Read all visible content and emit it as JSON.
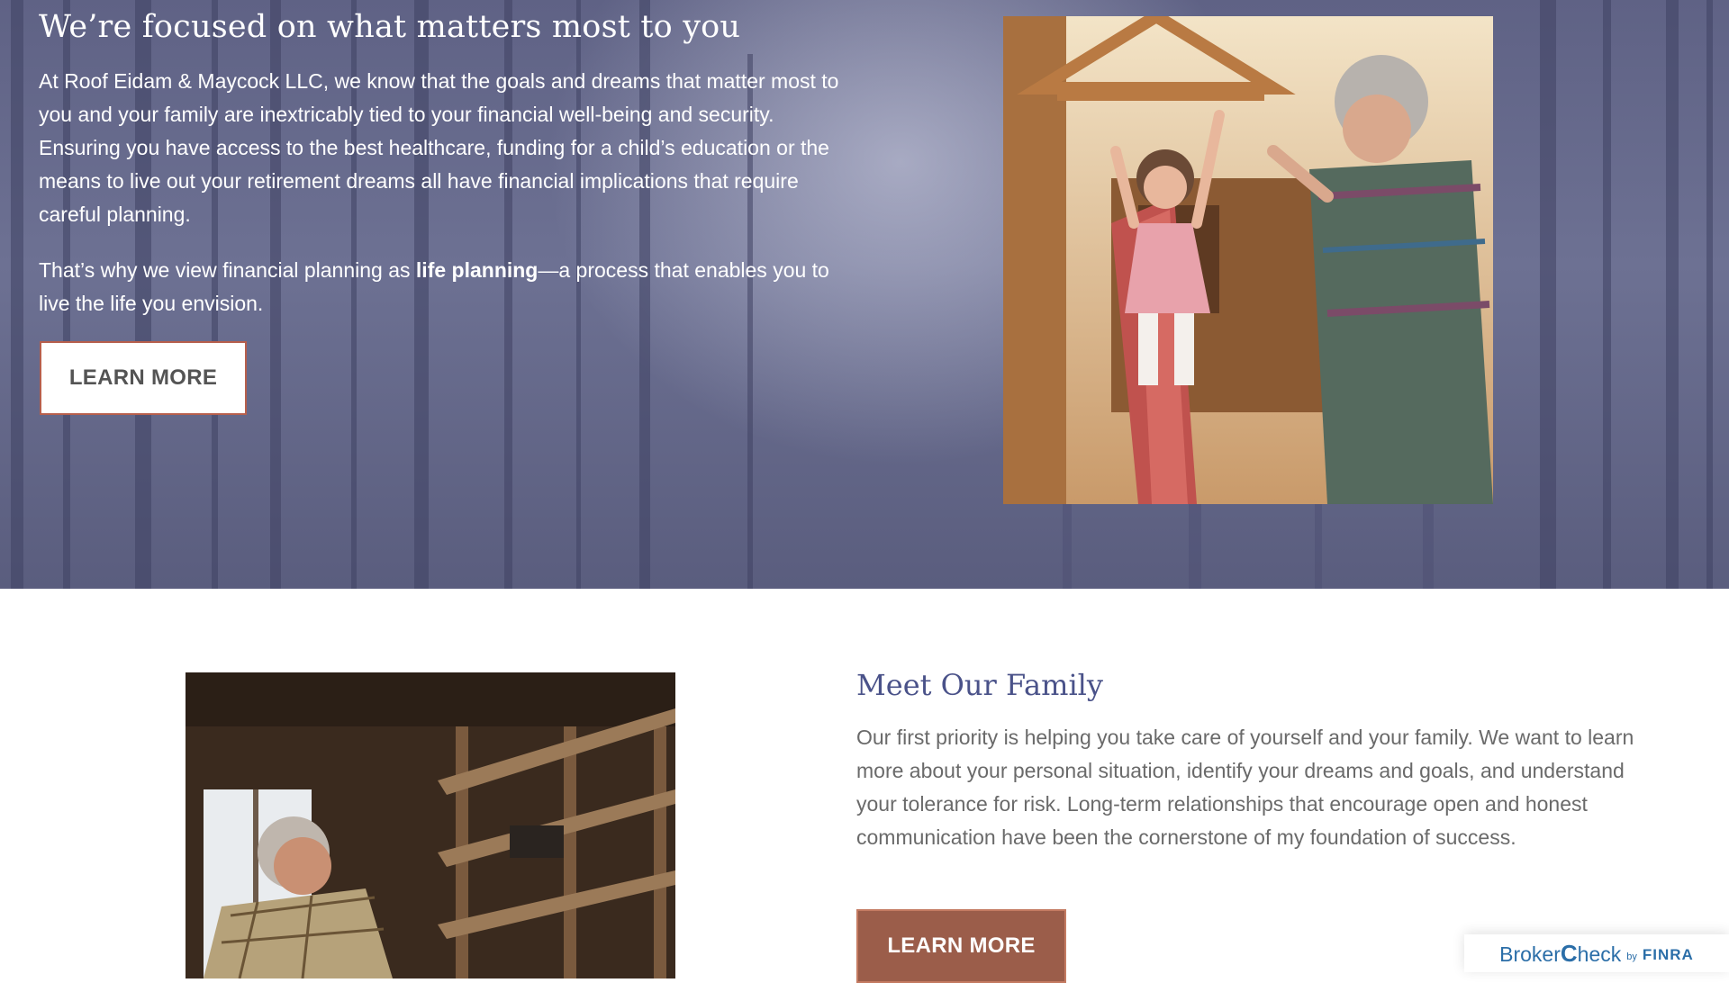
{
  "hero": {
    "title": "We’re focused on what matters most to you",
    "paragraph1": "At Roof Eidam & Maycock LLC, we know that the goals and dreams that matter most to you and your family are inextricably tied to your financial well-being and security. Ensuring you have access to the best healthcare, funding for a child’s education or the means to live out your retirement dreams all have financial implications that require careful planning.",
    "paragraph2_before": "That’s why we view financial planning as ",
    "paragraph2_bold": "life planning",
    "paragraph2_after": "—a process that enables you to live the life you envision.",
    "button_label": "LEARN MORE"
  },
  "family": {
    "title": "Meet Our Family",
    "paragraph": "Our first priority is helping you take care of yourself and your family. We want to learn more about your personal situation, identify your dreams and goals, and understand your tolerance for risk. Long-term relationships that encourage open and honest communication have been the cornerstone of my foundation of success.",
    "button_label": "LEARN MORE"
  },
  "brokercheck": {
    "brand_prefix": "Broker",
    "brand_c": "C",
    "brand_suffix": "heck",
    "by": "by",
    "finra": "FINRA"
  },
  "colors": {
    "hero_bg": "#5f6285",
    "title_blue": "#4a5289",
    "button_accent": "#9b5d4a",
    "brokercheck_blue": "#2b6ea8"
  }
}
